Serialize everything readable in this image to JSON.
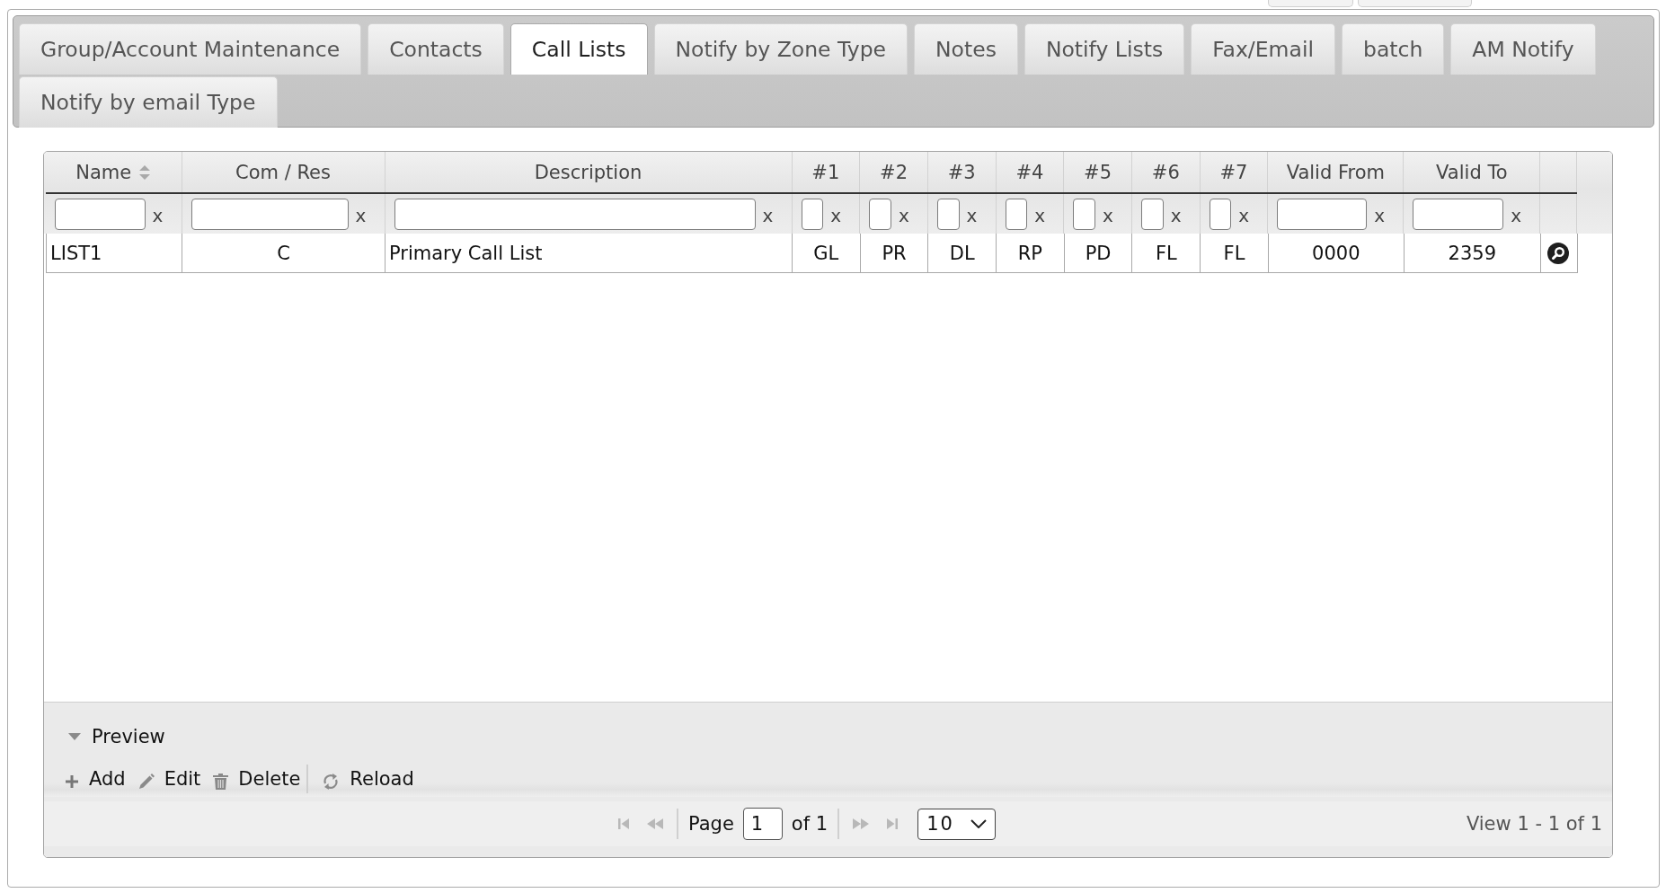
{
  "tabs": [
    {
      "label": "Group/Account Maintenance",
      "selected": false
    },
    {
      "label": "Contacts",
      "selected": false
    },
    {
      "label": "Call Lists",
      "selected": true
    },
    {
      "label": "Notify by Zone Type",
      "selected": false
    },
    {
      "label": "Notes",
      "selected": false
    },
    {
      "label": "Notify Lists",
      "selected": false
    },
    {
      "label": "Fax/Email",
      "selected": false
    },
    {
      "label": "batch",
      "selected": false
    },
    {
      "label": "AM Notify",
      "selected": false
    },
    {
      "label": "Notify by email Type",
      "selected": false
    }
  ],
  "grid": {
    "columns": [
      {
        "label": "Name",
        "sort_indicator": true,
        "filter_clear": "x"
      },
      {
        "label": "Com / Res",
        "sort_indicator": false,
        "filter_clear": "x"
      },
      {
        "label": "Description",
        "sort_indicator": false,
        "filter_clear": "x"
      },
      {
        "label": "#1",
        "sort_indicator": false,
        "filter_clear": "x"
      },
      {
        "label": "#2",
        "sort_indicator": false,
        "filter_clear": "x"
      },
      {
        "label": "#3",
        "sort_indicator": false,
        "filter_clear": "x"
      },
      {
        "label": "#4",
        "sort_indicator": false,
        "filter_clear": "x"
      },
      {
        "label": "#5",
        "sort_indicator": false,
        "filter_clear": "x"
      },
      {
        "label": "#6",
        "sort_indicator": false,
        "filter_clear": "x"
      },
      {
        "label": "#7",
        "sort_indicator": false,
        "filter_clear": "x"
      },
      {
        "label": "Valid From",
        "sort_indicator": false,
        "filter_clear": "x"
      },
      {
        "label": "Valid To",
        "sort_indicator": false,
        "filter_clear": "x"
      }
    ],
    "rows": [
      {
        "cells": [
          "LIST1",
          "C",
          "Primary Call List",
          "GL",
          "PR",
          "DL",
          "RP",
          "PD",
          "FL",
          "FL",
          "0000",
          "2359"
        ]
      }
    ],
    "preview": {
      "label": "Preview",
      "expanded": true
    },
    "toolbar": {
      "groups": [
        {
          "buttons": [
            {
              "kind": "add",
              "label": "Add"
            },
            {
              "kind": "edit",
              "label": "Edit"
            },
            {
              "kind": "delete",
              "label": "Delete"
            }
          ]
        },
        {
          "buttons": [
            {
              "kind": "reload",
              "label": "Reload"
            }
          ]
        }
      ]
    },
    "pager": {
      "nav_before": [
        {
          "kind": "first",
          "disabled": true
        },
        {
          "kind": "prev",
          "disabled": true
        }
      ],
      "page_label": "Page",
      "page": "1",
      "of_label": "of 1",
      "nav_after": [
        {
          "kind": "next",
          "disabled": true
        },
        {
          "kind": "last",
          "disabled": true
        }
      ],
      "page_size": "10",
      "record_info": "View 1 - 1 of 1"
    }
  }
}
